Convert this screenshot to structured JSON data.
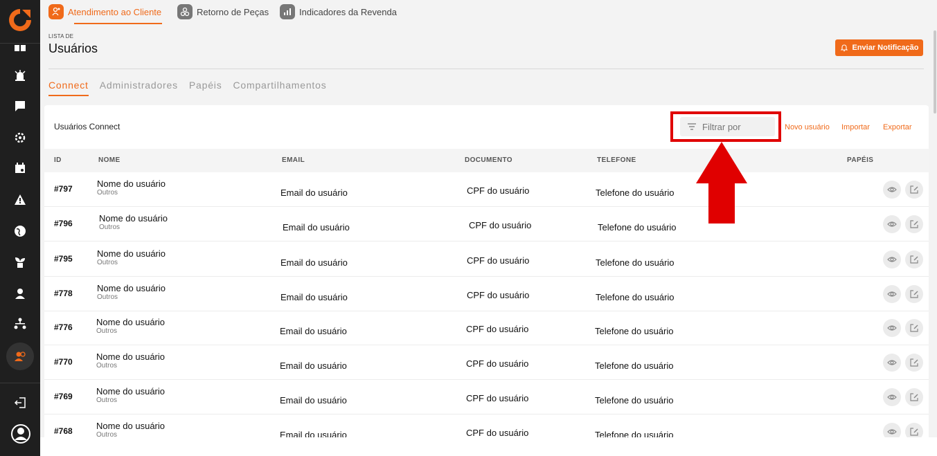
{
  "topnav": {
    "items": [
      {
        "label": "Atendimento ao Cliente",
        "active": true
      },
      {
        "label": "Retorno de Peças",
        "active": false
      },
      {
        "label": "Indicadores da Revenda",
        "active": false
      }
    ]
  },
  "sidebar": {
    "icons": [
      "dashboard-icon",
      "alarm-icon",
      "chat-icon",
      "settings-cog-icon",
      "calendar-icon",
      "warning-icon",
      "globe-icon",
      "plant-icon",
      "location-user-icon",
      "hierarchy-icon",
      "users-icon",
      "logout-icon",
      "user-avatar-icon"
    ],
    "active": "users-icon"
  },
  "header": {
    "crumb": "LISTA DE",
    "title": "Usuários",
    "notify_label": "Enviar Notificação"
  },
  "tabs": [
    {
      "label": "Connect",
      "active": true
    },
    {
      "label": "Administradores",
      "active": false
    },
    {
      "label": "Papéis",
      "active": false
    },
    {
      "label": "Compartilhamentos",
      "active": false
    }
  ],
  "card": {
    "title": "Usuários Connect",
    "filter_placeholder": "Filtrar por",
    "new_user": "Novo usuário",
    "import": "Importar",
    "export": "Exportar"
  },
  "table": {
    "columns": [
      "ID",
      "NOME",
      "EMAIL",
      "DOCUMENTO",
      "TELEFONE",
      "PAPÉIS"
    ],
    "rows": [
      {
        "id": "#797",
        "name": "Nome do usuário",
        "role": "Outros",
        "email": "Email do usuário",
        "doc": "CPF do usuário",
        "phone": "Telefone do usuário"
      },
      {
        "id": "#796",
        "name": "Nome do usuário",
        "role": "Outros",
        "email": "Email do usuário",
        "doc": "CPF do usuário",
        "phone": "Telefone do usuário"
      },
      {
        "id": "#795",
        "name": "Nome do usuário",
        "role": "Outros",
        "email": "Email do usuário",
        "doc": "CPF do usuário",
        "phone": "Telefone do usuário"
      },
      {
        "id": "#778",
        "name": "Nome do usuário",
        "role": "Outros",
        "email": "Email do usuário",
        "doc": "CPF do usuário",
        "phone": "Telefone do usuário"
      },
      {
        "id": "#776",
        "name": "Nome do usuário",
        "role": "Outros",
        "email": "Email do usuário",
        "doc": "CPF do usuário",
        "phone": "Telefone do usuário"
      },
      {
        "id": "#770",
        "name": "Nome do usuário",
        "role": "Outros",
        "email": "Email do usuário",
        "doc": "CPF do usuário",
        "phone": "Telefone do usuário"
      },
      {
        "id": "#769",
        "name": "Nome do usuário",
        "role": "Outros",
        "email": "Email do usuário",
        "doc": "CPF do usuário",
        "phone": "Telefone do usuário"
      },
      {
        "id": "#768",
        "name": "Nome do usuário",
        "role": "Outros",
        "email": "Email do usuário",
        "doc": "CPF do usuário",
        "phone": "Telefone do usuário"
      }
    ]
  },
  "colors": {
    "accent": "#f06a1a",
    "sidebar": "#1f1f1f",
    "annotation": "#e00000"
  }
}
